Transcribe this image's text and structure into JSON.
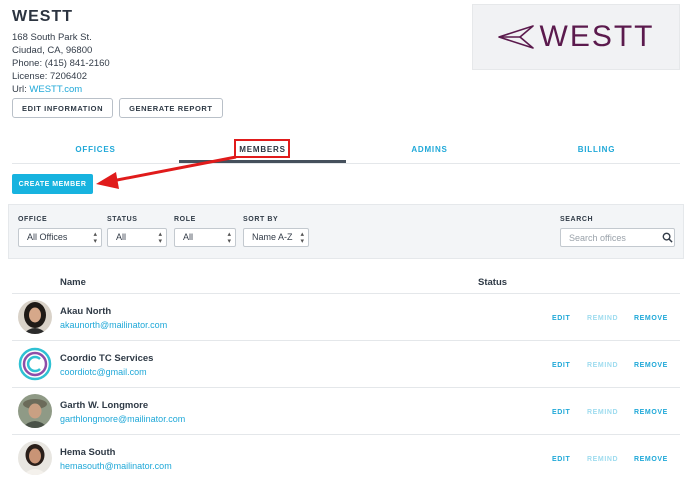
{
  "company": {
    "name": "WESTT",
    "address": "168 South Park St.",
    "city": "Ciudad, CA, 96800",
    "phone": "Phone: (415) 841-2160",
    "license": "License: 7206402",
    "url_label": "Url:",
    "url": "WESTT.com"
  },
  "actions": {
    "edit_info": "EDIT INFORMATION",
    "generate_report": "GENERATE REPORT"
  },
  "logo": {
    "text": "WESTT",
    "color": "#5b1a4d"
  },
  "tabs": [
    {
      "label": "OFFICES",
      "active": false
    },
    {
      "label": "MEMBERS",
      "active": true
    },
    {
      "label": "ADMINS",
      "active": false
    },
    {
      "label": "BILLING",
      "active": false
    }
  ],
  "create_member": "CREATE MEMBER",
  "filters": {
    "office": {
      "label": "OFFICE",
      "value": "All Offices"
    },
    "status": {
      "label": "STATUS",
      "value": "All"
    },
    "role": {
      "label": "ROLE",
      "value": "All"
    },
    "sort": {
      "label": "SORT BY",
      "value": "Name A-Z"
    },
    "search": {
      "label": "SEARCH",
      "placeholder": "Search offices"
    }
  },
  "table": {
    "headers": {
      "name": "Name",
      "status": "Status"
    },
    "row_actions": {
      "edit": "EDIT",
      "remind": "REMIND",
      "remove": "REMOVE"
    },
    "members": [
      {
        "name": "Akau North",
        "email": "akaunorth@mailinator.com",
        "avatar": "photo-woman-dark-hair-icon"
      },
      {
        "name": "Coordio TC Services",
        "email": "coordiotc@gmail.com",
        "avatar": "coordio-logo-icon"
      },
      {
        "name": "Garth W. Longmore",
        "email": "garthlongmore@mailinator.com",
        "avatar": "photo-man-hat-icon"
      },
      {
        "name": "Hema South",
        "email": "hemasouth@mailinator.com",
        "avatar": "photo-woman-light-top-icon"
      }
    ]
  },
  "colors": {
    "accent": "#1fa8d8",
    "create_button": "#17b3df",
    "annotation_red": "#e01b1b"
  }
}
